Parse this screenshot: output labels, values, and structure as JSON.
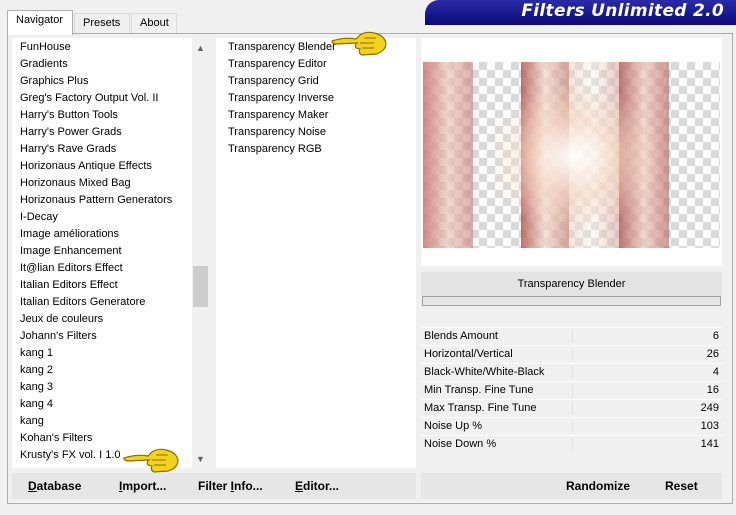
{
  "tabs": {
    "navigator": "Navigator",
    "presets": "Presets",
    "about": "About"
  },
  "banner": {
    "title": "Filters Unlimited 2.0"
  },
  "categories": [
    "FunHouse",
    "Gradients",
    "Graphics Plus",
    "Greg's Factory Output Vol. II",
    "Harry's Button Tools",
    "Harry's Power Grads",
    "Harry's Rave Grads",
    "Horizonaus Antique Effects",
    "Horizonaus Mixed Bag",
    "Horizonaus Pattern Generators",
    "I-Decay",
    "Image améliorations",
    "Image Enhancement",
    "It@lian Editors Effect",
    "Italian Editors Effect",
    "Italian Editors Generatore",
    "Jeux de couleurs",
    "Johann's Filters",
    "kang 1",
    "kang 2",
    "kang 3",
    "kang 4",
    "kang",
    "Kohan's Filters",
    "Krusty's FX vol. I 1.0"
  ],
  "filters": [
    "Transparency Blender",
    "Transparency Editor",
    "Transparency Grid",
    "Transparency Inverse",
    "Transparency Maker",
    "Transparency Noise",
    "Transparency RGB"
  ],
  "selected_filter": "Transparency Blender",
  "params": [
    {
      "label": "Blends Amount",
      "value": "6"
    },
    {
      "label": "Horizontal/Vertical",
      "value": "26"
    },
    {
      "label": "Black-White/White-Black",
      "value": "4"
    },
    {
      "label": "Min Transp. Fine Tune",
      "value": "16"
    },
    {
      "label": "Max Transp. Fine Tune",
      "value": "249"
    },
    {
      "label": "Noise Up %",
      "value": "103"
    },
    {
      "label": "Noise Down %",
      "value": "141"
    }
  ],
  "buttons": {
    "database_first": "D",
    "database_rest": "atabase",
    "import_first": "I",
    "import_rest": "mport...",
    "filterinfo_pre": "Filter ",
    "filterinfo_ul": "I",
    "filterinfo_rest": "nfo...",
    "editor_first": "E",
    "editor_rest": "ditor...",
    "randomize": "Randomize",
    "reset": "Reset"
  },
  "colors": {
    "banner": "#1a1a90",
    "hand": "#f2d31a"
  }
}
